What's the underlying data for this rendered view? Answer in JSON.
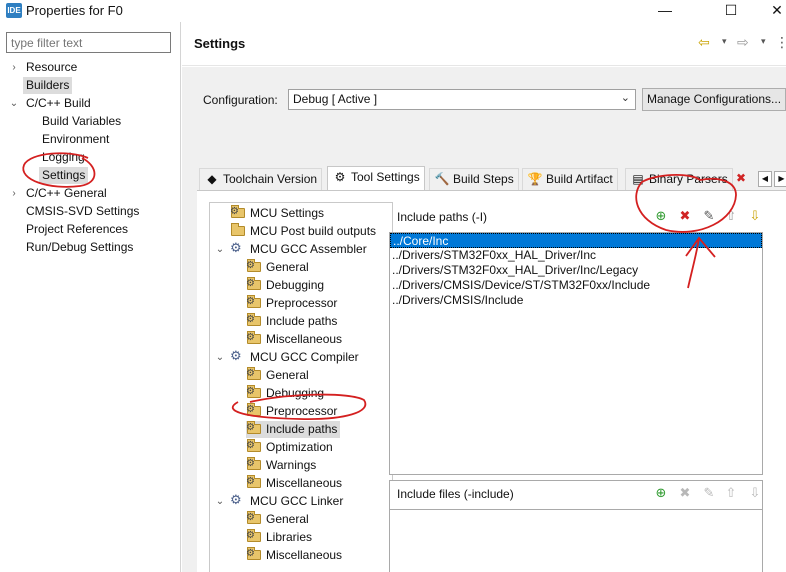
{
  "window": {
    "app_icon": "IDE",
    "title": "Properties for F0",
    "minimize": "—",
    "maximize": "☐",
    "close": "✕"
  },
  "left_pane": {
    "filter_placeholder": "type filter text",
    "items": [
      {
        "label": "Resource",
        "twisty": "›"
      },
      {
        "label": "Builders",
        "twisty": ""
      },
      {
        "label": "C/C++ Build",
        "twisty": "⌄"
      },
      {
        "label": "Build Variables",
        "twisty": ""
      },
      {
        "label": "Environment",
        "twisty": ""
      },
      {
        "label": "Logging",
        "twisty": ""
      },
      {
        "label": "Settings",
        "twisty": ""
      },
      {
        "label": "C/C++ General",
        "twisty": "›"
      },
      {
        "label": "CMSIS-SVD Settings",
        "twisty": ""
      },
      {
        "label": "Project References",
        "twisty": ""
      },
      {
        "label": "Run/Debug Settings",
        "twisty": ""
      }
    ],
    "selected": "Settings"
  },
  "header": {
    "title": "Settings",
    "back_icon": "⇦",
    "forward_icon": "⇨",
    "menu_icon": "⋮",
    "caret": "▾"
  },
  "configuration": {
    "label": "Configuration:",
    "value": "Debug  [ Active ]",
    "manage_button": "Manage Configurations..."
  },
  "tabs": [
    {
      "label": "Toolchain  Version",
      "icon": "◆"
    },
    {
      "label": "Tool Settings",
      "icon": "⚙"
    },
    {
      "label": "Build Steps",
      "icon": "🔨"
    },
    {
      "label": "Build Artifact",
      "icon": "🏆"
    },
    {
      "label": "Binary Parsers",
      "icon": "▤"
    }
  ],
  "tab_extra": {
    "error_icon": "✖",
    "scroll_left": "◀",
    "scroll_right": "▶"
  },
  "active_tab": "Tool Settings",
  "tool_tree": [
    {
      "label": "MCU Settings",
      "icon": "folder-gear",
      "twisty": ""
    },
    {
      "label": "MCU Post build outputs",
      "icon": "folder",
      "twisty": ""
    },
    {
      "label": "MCU GCC Assembler",
      "icon": "tool",
      "twisty": "⌄"
    },
    {
      "label": "General",
      "icon": "folder-gear",
      "twisty": ""
    },
    {
      "label": "Debugging",
      "icon": "folder-gear",
      "twisty": ""
    },
    {
      "label": "Preprocessor",
      "icon": "folder-gear",
      "twisty": ""
    },
    {
      "label": "Include paths",
      "icon": "folder-gear",
      "twisty": ""
    },
    {
      "label": "Miscellaneous",
      "icon": "folder-gear",
      "twisty": ""
    },
    {
      "label": "MCU GCC Compiler",
      "icon": "tool",
      "twisty": "⌄"
    },
    {
      "label": "General",
      "icon": "folder-gear",
      "twisty": ""
    },
    {
      "label": "Debugging",
      "icon": "folder-gear",
      "twisty": ""
    },
    {
      "label": "Preprocessor",
      "icon": "folder-gear",
      "twisty": ""
    },
    {
      "label": "Include paths",
      "icon": "folder-gear",
      "twisty": ""
    },
    {
      "label": "Optimization",
      "icon": "folder-gear",
      "twisty": ""
    },
    {
      "label": "Warnings",
      "icon": "folder-gear",
      "twisty": ""
    },
    {
      "label": "Miscellaneous",
      "icon": "folder-gear",
      "twisty": ""
    },
    {
      "label": "MCU GCC Linker",
      "icon": "tool",
      "twisty": "⌄"
    },
    {
      "label": "General",
      "icon": "folder-gear",
      "twisty": ""
    },
    {
      "label": "Libraries",
      "icon": "folder-gear",
      "twisty": ""
    },
    {
      "label": "Miscellaneous",
      "icon": "folder-gear",
      "twisty": ""
    }
  ],
  "tool_tree_selected": "Include paths (MCU GCC Compiler)",
  "include_paths": {
    "title": "Include paths (-I)",
    "items": [
      "../Core/Inc",
      "../Drivers/STM32F0xx_HAL_Driver/Inc",
      "../Drivers/STM32F0xx_HAL_Driver/Inc/Legacy",
      "../Drivers/CMSIS/Device/ST/STM32F0xx/Include",
      "../Drivers/CMSIS/Include"
    ],
    "selected_index": 0,
    "toolbar": [
      {
        "name": "add-icon",
        "glyph": "⊕",
        "color": "#2e9a2e"
      },
      {
        "name": "delete-icon",
        "glyph": "✖",
        "color": "#d02424"
      },
      {
        "name": "edit-icon",
        "glyph": "✎",
        "color": "#555555"
      },
      {
        "name": "move-up-icon",
        "glyph": "⇧",
        "color": "#9a9a9a"
      },
      {
        "name": "move-down-icon",
        "glyph": "⇩",
        "color": "#c9a200"
      }
    ]
  },
  "include_files": {
    "title": "Include files (-include)",
    "items": [],
    "toolbar": [
      {
        "name": "add-icon",
        "glyph": "⊕",
        "color": "#2e9a2e"
      },
      {
        "name": "delete-icon",
        "glyph": "✖",
        "color": "#b8b8b8"
      },
      {
        "name": "edit-icon",
        "glyph": "✎",
        "color": "#b8b8b8"
      },
      {
        "name": "move-up-icon",
        "glyph": "⇧",
        "color": "#b8b8b8"
      },
      {
        "name": "move-down-icon",
        "glyph": "⇩",
        "color": "#b8b8b8"
      }
    ]
  },
  "colors": {
    "selection": "#0078d7",
    "annotation": "#d42020"
  }
}
